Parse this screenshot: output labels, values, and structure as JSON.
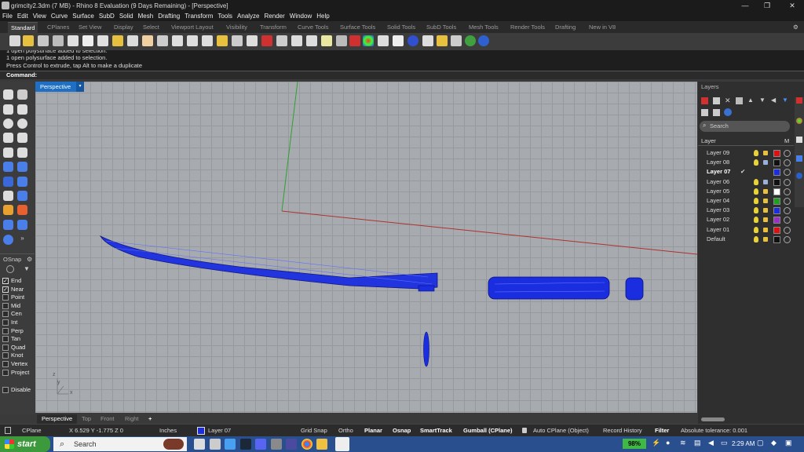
{
  "window": {
    "title": "grimcity2.3dm (7 MB) - Rhino 8 Evaluation (9 Days Remaining) - [Perspective]",
    "minimize": "—",
    "maximize": "❐",
    "close": "✕"
  },
  "menu": [
    "File",
    "Edit",
    "View",
    "Curve",
    "Surface",
    "SubD",
    "Solid",
    "Mesh",
    "Drafting",
    "Transform",
    "Tools",
    "Analyze",
    "Render",
    "Window",
    "Help"
  ],
  "toolbar_tabs": [
    "Standard",
    "CPlanes",
    "Set View",
    "Display",
    "Select",
    "Viewport Layout",
    "Visibility",
    "Transform",
    "Curve Tools",
    "Surface Tools",
    "Solid Tools",
    "SubD Tools",
    "Mesh Tools",
    "Render Tools",
    "Drafting",
    "New in V8"
  ],
  "command_history": [
    "1 open polysurface added to selection.",
    "1 open polysurface added to selection.",
    "Press Control to extrude, tap Alt to make a duplicate"
  ],
  "command_prompt": "Command:",
  "viewport": {
    "active_label": "Perspective",
    "dropdown_glyph": "▾",
    "tabs": [
      "Perspective",
      "Top",
      "Front",
      "Right"
    ],
    "add_tab": "+",
    "axis_labels": {
      "x": "x",
      "y": "y",
      "z": "z"
    }
  },
  "osnap": {
    "title": "OSnap",
    "items": [
      {
        "label": "End",
        "checked": true
      },
      {
        "label": "Near",
        "checked": true
      },
      {
        "label": "Point",
        "checked": false
      },
      {
        "label": "Mid",
        "checked": false
      },
      {
        "label": "Cen",
        "checked": false
      },
      {
        "label": "Int",
        "checked": false
      },
      {
        "label": "Perp",
        "checked": false
      },
      {
        "label": "Tan",
        "checked": false
      },
      {
        "label": "Quad",
        "checked": false
      },
      {
        "label": "Knot",
        "checked": false
      },
      {
        "label": "Vertex",
        "checked": false
      },
      {
        "label": "Project",
        "checked": false
      }
    ],
    "disable": "Disable"
  },
  "layers": {
    "title": "Layers",
    "search_placeholder": "Search",
    "header_layer": "Layer",
    "header_m": "M",
    "rows": [
      {
        "name": "Layer 09",
        "color": "#e01010",
        "current": false
      },
      {
        "name": "Layer 08",
        "color": "#111111",
        "current": false
      },
      {
        "name": "Layer 07",
        "color": "#1a2ee0",
        "current": true
      },
      {
        "name": "Layer 06",
        "color": "#111111",
        "current": false
      },
      {
        "name": "Layer 05",
        "color": "#ffffff",
        "current": false
      },
      {
        "name": "Layer 04",
        "color": "#20a020",
        "current": false
      },
      {
        "name": "Layer 03",
        "color": "#1a2ee0",
        "current": false
      },
      {
        "name": "Layer 02",
        "color": "#9b2ec9",
        "current": false
      },
      {
        "name": "Layer 01",
        "color": "#e01010",
        "current": false
      },
      {
        "name": "Default",
        "color": "#111111",
        "current": false
      }
    ],
    "current_mark": "✔"
  },
  "status": {
    "cplane": "CPlane",
    "coords": "X 6.529 Y -1.775 Z 0",
    "units": "Inches",
    "layer": "Layer 07",
    "layer_color": "#1a2ee0",
    "grid_snap": "Grid Snap",
    "ortho": "Ortho",
    "planar": "Planar",
    "osnap": "Osnap",
    "smarttrack": "SmartTrack",
    "gumball": "Gumball (CPlane)",
    "auto_cplane": "Auto CPlane (Object)",
    "record_history": "Record History",
    "filter": "Filter",
    "tolerance": "Absolute tolerance: 0.001"
  },
  "taskbar": {
    "start": "start",
    "search": "Search",
    "battery": "98%",
    "time": "2:29 AM"
  },
  "colors": {
    "object_blue": "#1a2ee0",
    "grid_bg": "#a7abaf",
    "x_axis": "#b03030",
    "y_axis": "#30a030"
  }
}
